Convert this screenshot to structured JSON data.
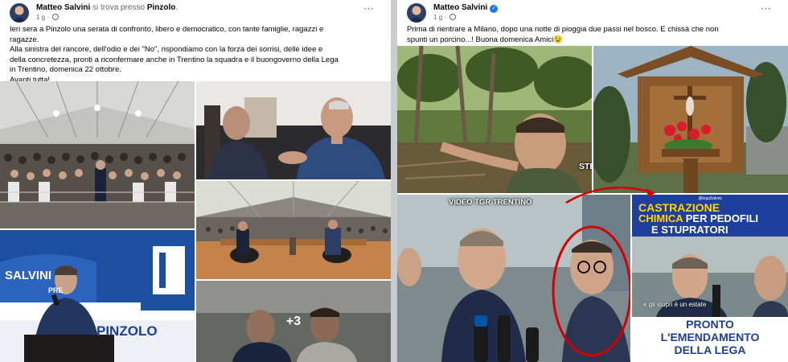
{
  "colors": {
    "facebook_blue": "#1877f2",
    "meta_gray": "#65676b",
    "lega_blue": "#1c3d9a",
    "banner_yellow": "#ffd600",
    "annotation_red": "#d40000"
  },
  "left_post": {
    "author": "Matteo Salvini",
    "location_prefix": "si trova presso",
    "location": "Pinzolo",
    "location_suffix": ".",
    "time": "1 g",
    "more_icon": "⋯",
    "text_lines": [
      "Ieri sera a Pinzolo una serata di confronto, libero e democratico, con tante famiglie, ragazzi e",
      "ragazze.",
      "Alla sinistra del rancore, dell'odio e dei \"No\", rispondiamo con la forza dei sorrisi, delle idee e",
      "della concretezza, pronti a riconfermare anche in Trentino la squadra e il buongoverno della Lega",
      "in Trentino, domenica 22 ottobre.",
      "Avanti tutta!"
    ],
    "photo_sign_salvini": "SALVINI",
    "photo_sign_premier": "PRE",
    "photo_sign_pinzolo": "PINZOLO",
    "more_photos": "+3"
  },
  "right_post": {
    "author": "Matteo Salvini",
    "verified_icon": "✓",
    "time": "1 g",
    "more_icon": "⋯",
    "text_lines": [
      "Prima di rientrare a Milano, dopo una notte di pioggia due passi nel bosco. E chissà che non",
      "spunti un porcino...! Buona domenica Amici😉"
    ],
    "overlay_stessa_scena": "STESSA SCENA ANGOLO DIVERSO",
    "overlay_video_tgr": "VIDEO TGR TRENTINO",
    "banner_line1_yellow": "CASTRAZIONE",
    "banner_line2_yellow": "CHIMICA",
    "banner_line2_white": "PER PEDOFILI",
    "banner_line3": "E STUPRATORI",
    "banner_handle": "@legaSalvini",
    "caption": "e gli stupri è un estate",
    "banner_bottom1": "PRONTO",
    "banner_bottom2": "L'EMENDAMENTO",
    "banner_bottom3": "DELLA LEGA"
  }
}
